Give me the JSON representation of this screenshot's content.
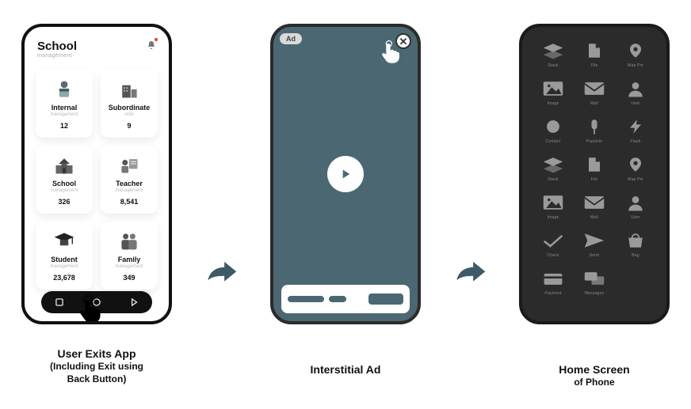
{
  "captions": {
    "exit": {
      "line1": "User Exits App",
      "line2": "(Including Exit using",
      "line3": "Back Button)"
    },
    "ad": "Interstitial Ad",
    "home": {
      "line1": "Home Screen",
      "line2": "of Phone"
    }
  },
  "app": {
    "title": "School",
    "subtitle": "management",
    "cards": [
      {
        "name": "Internal",
        "sub": "management",
        "count": "12"
      },
      {
        "name": "Subordinate",
        "sub": "units",
        "count": "9"
      },
      {
        "name": "School",
        "sub": "management",
        "count": "326"
      },
      {
        "name": "Teacher",
        "sub": "management",
        "count": "8,541"
      },
      {
        "name": "Student",
        "sub": "management",
        "count": "23,678"
      },
      {
        "name": "Family",
        "sub": "management",
        "count": "349"
      }
    ]
  },
  "ad": {
    "badge": "Ad"
  },
  "home_icons": [
    {
      "name": "Stack",
      "shape": "stack"
    },
    {
      "name": "File",
      "shape": "file"
    },
    {
      "name": "Map Pin",
      "shape": "pin"
    },
    {
      "name": "Image",
      "shape": "image"
    },
    {
      "name": "Mail",
      "shape": "mail"
    },
    {
      "name": "User",
      "shape": "user"
    },
    {
      "name": "Contact",
      "shape": "circle"
    },
    {
      "name": "Popsicle",
      "shape": "pop"
    },
    {
      "name": "Flash",
      "shape": "bolt"
    },
    {
      "name": "Stack",
      "shape": "stack"
    },
    {
      "name": "File",
      "shape": "file"
    },
    {
      "name": "Map Pin",
      "shape": "pin"
    },
    {
      "name": "Image",
      "shape": "image"
    },
    {
      "name": "Mail",
      "shape": "mail"
    },
    {
      "name": "User",
      "shape": "user"
    },
    {
      "name": "Check",
      "shape": "check"
    },
    {
      "name": "Send",
      "shape": "send"
    },
    {
      "name": "Bag",
      "shape": "bag"
    },
    {
      "name": "Payment",
      "shape": "card"
    },
    {
      "name": "Messages",
      "shape": "chat"
    }
  ]
}
